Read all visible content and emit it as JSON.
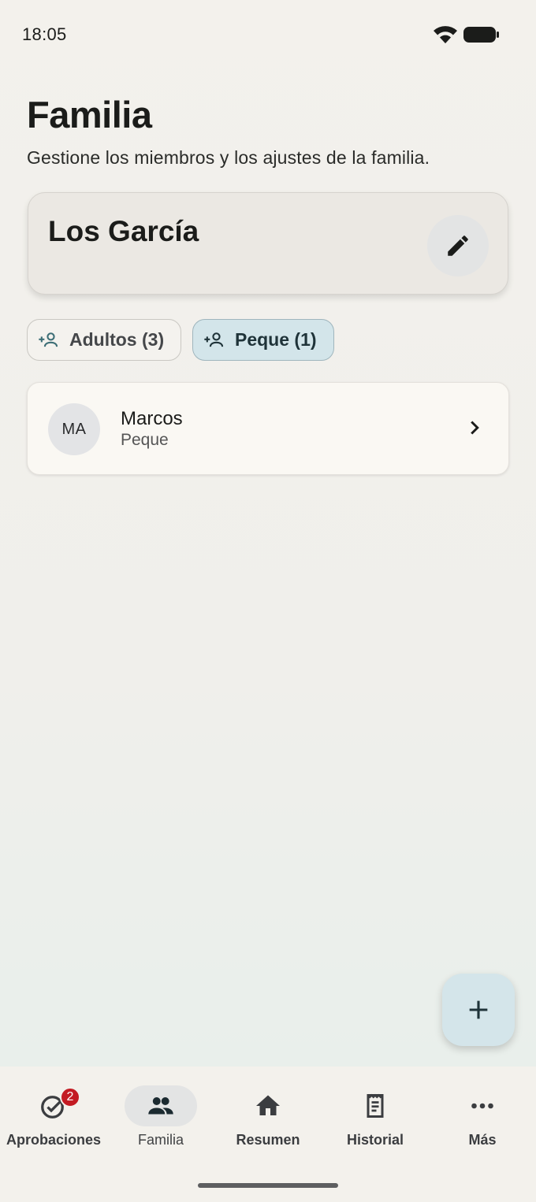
{
  "status_bar": {
    "time": "18:05"
  },
  "header": {
    "title": "Familia",
    "subtitle": "Gestione los miembros y los ajustes de la familia."
  },
  "family_card": {
    "name": "Los García"
  },
  "filters": [
    {
      "label": "Adultos (3)",
      "selected": false
    },
    {
      "label": "Peque (1)",
      "selected": true
    }
  ],
  "members": [
    {
      "initials": "MA",
      "name": "Marcos",
      "role": "Peque"
    }
  ],
  "bottom_nav": {
    "items": [
      {
        "label": "Aprobaciones",
        "icon": "approvals-check-icon",
        "badge": "2"
      },
      {
        "label": "Familia",
        "icon": "people-icon",
        "active": true
      },
      {
        "label": "Resumen",
        "icon": "home-icon"
      },
      {
        "label": "Historial",
        "icon": "receipt-icon"
      },
      {
        "label": "Más",
        "icon": "more-horizontal-icon"
      }
    ]
  },
  "colors": {
    "accent_container": "#d4e5ea",
    "badge": "#c31a22",
    "background": "#f3f1ec"
  }
}
